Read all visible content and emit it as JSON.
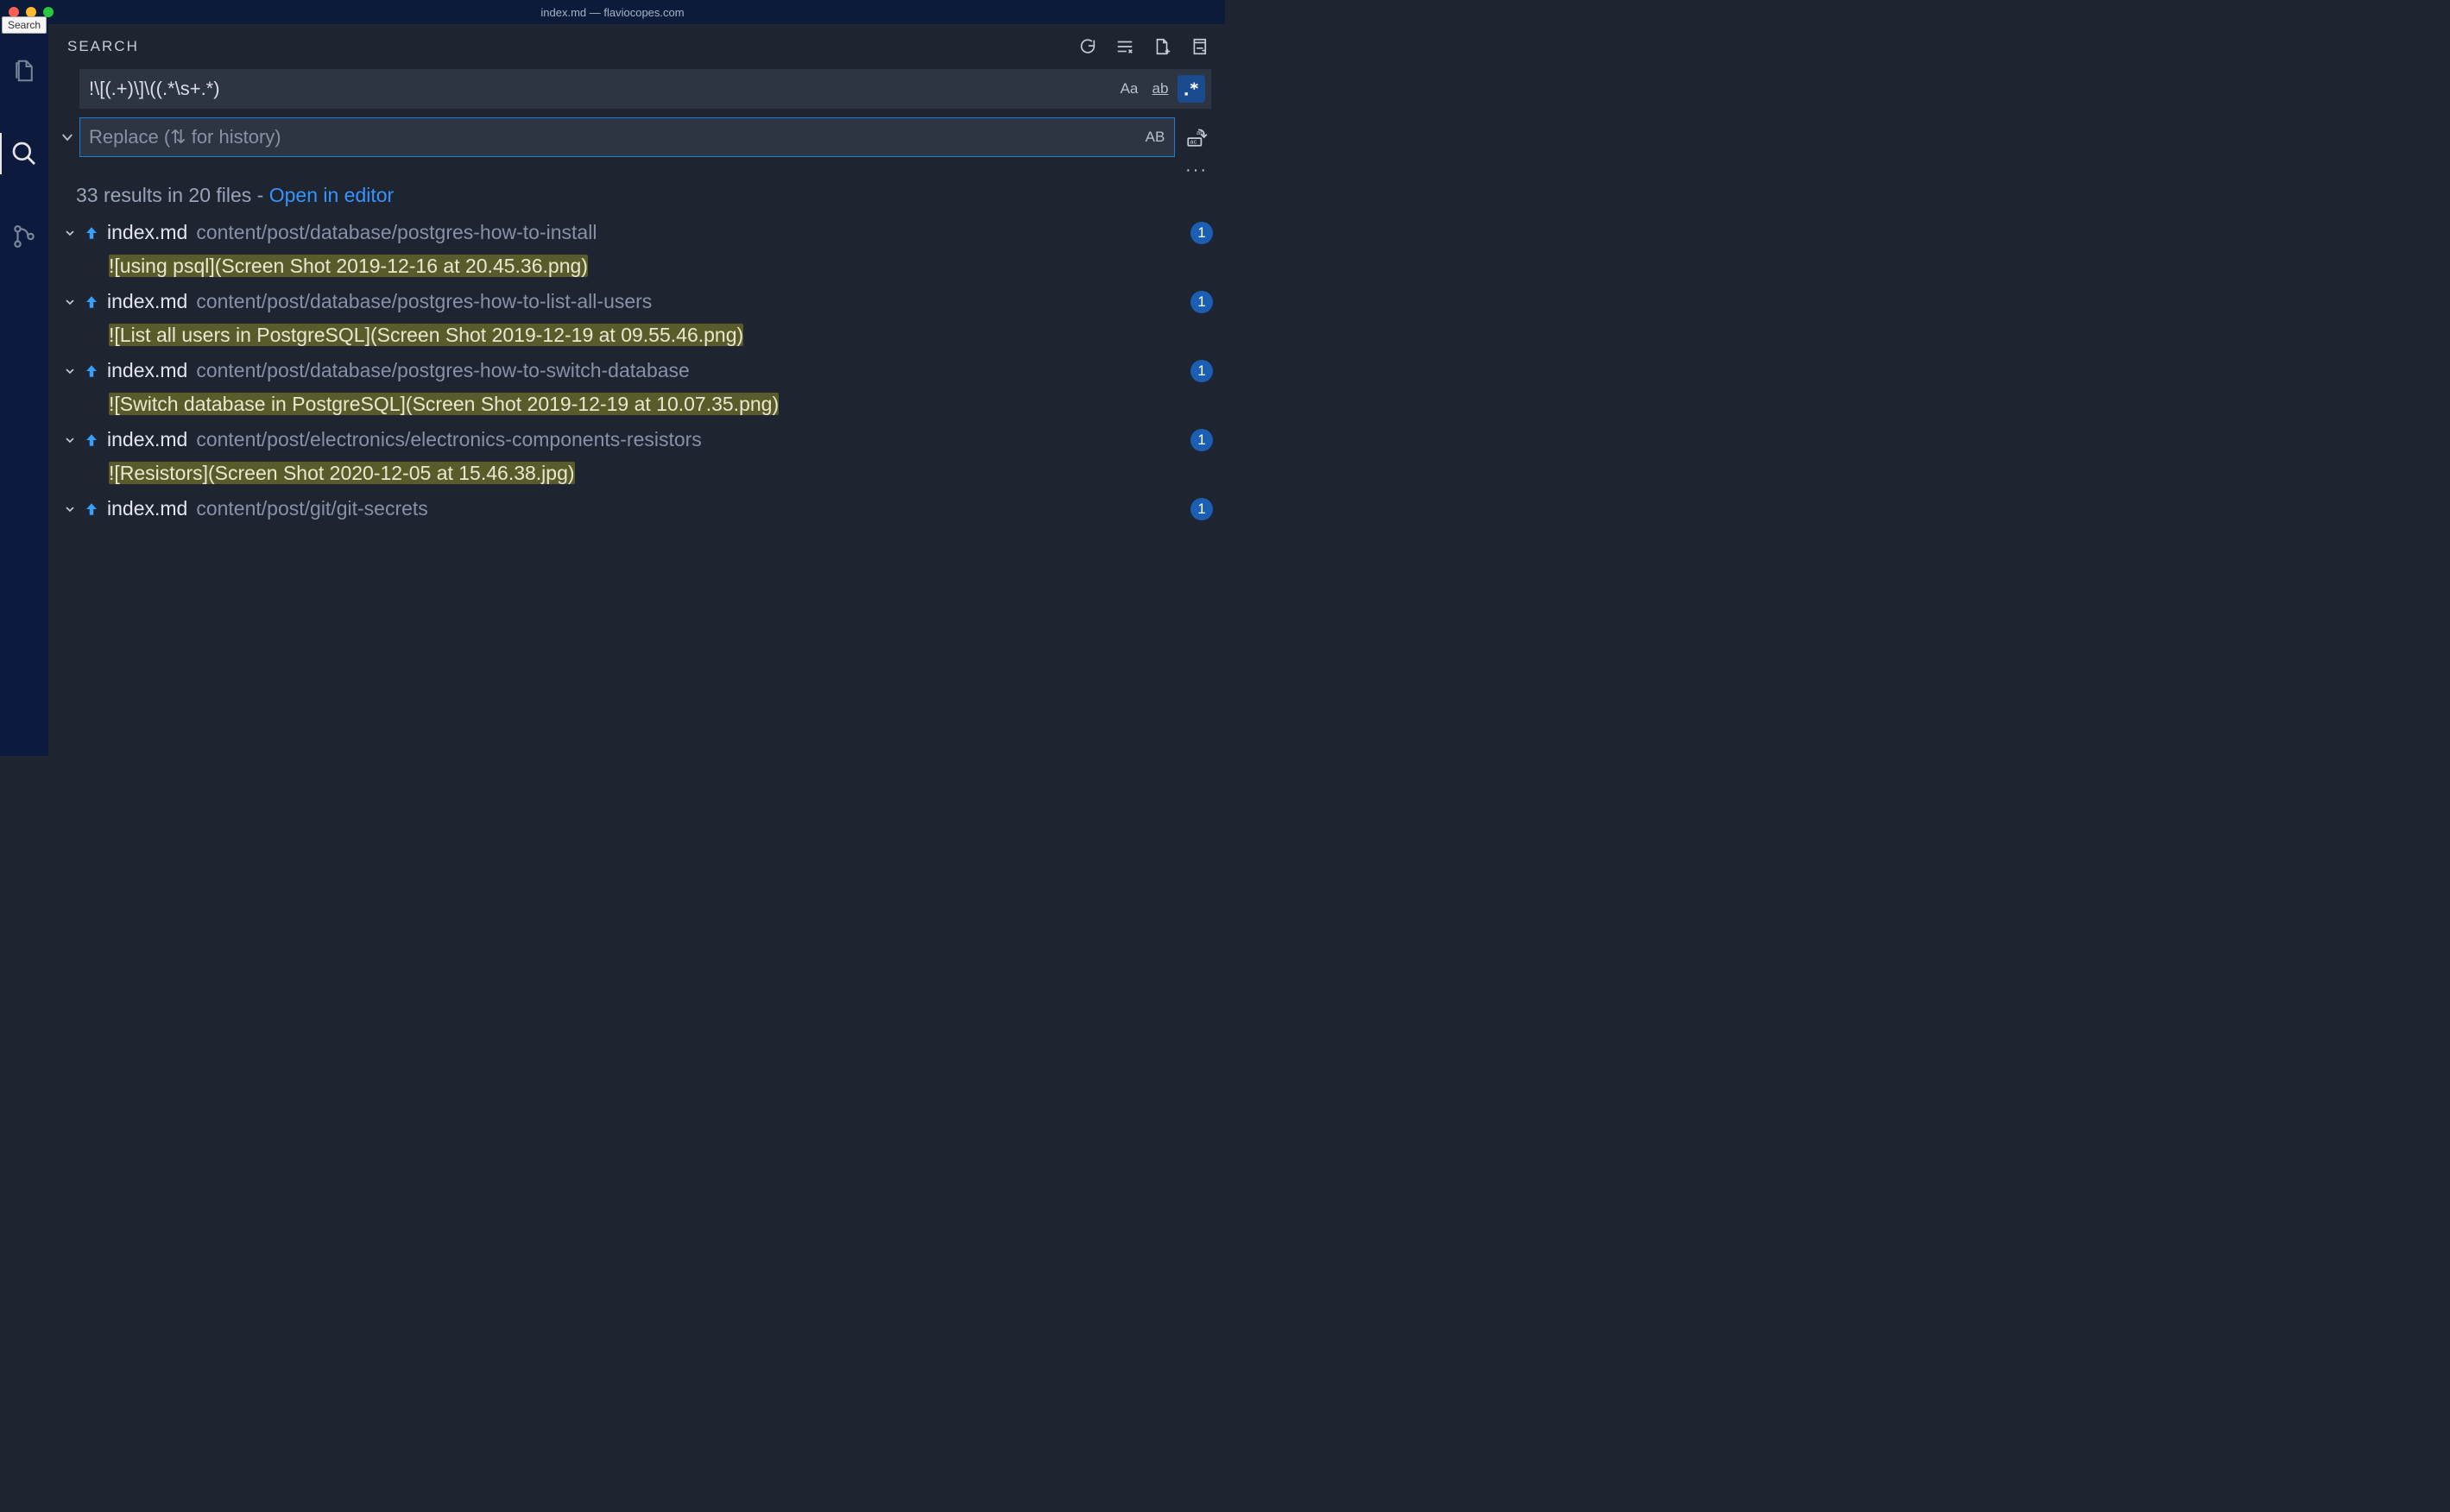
{
  "titlebar": {
    "title": "index.md — flaviocopes.com",
    "tooltip": "Search"
  },
  "panel": {
    "title": "SEARCH",
    "search_value": "!\\[(.+)\\]\\((.*\\s+.*)",
    "replace_placeholder": "Replace (⇅ for history)",
    "opts": {
      "case": "Aa",
      "word": "ab",
      "regex": "·*",
      "preserve": "AB"
    }
  },
  "summary": {
    "text": "33 results in 20 files - ",
    "link": "Open in editor"
  },
  "files": [
    {
      "name": "index.md",
      "path": "content/post/database/postgres-how-to-install",
      "count": "1",
      "match": "![using psql](Screen Shot 2019-12-16 at 20.45.36.png)"
    },
    {
      "name": "index.md",
      "path": "content/post/database/postgres-how-to-list-all-users",
      "count": "1",
      "match": "![List all users in PostgreSQL](Screen Shot 2019-12-19 at 09.55.46.png)"
    },
    {
      "name": "index.md",
      "path": "content/post/database/postgres-how-to-switch-database",
      "count": "1",
      "match": "![Switch database in PostgreSQL](Screen Shot 2019-12-19 at 10.07.35.png)"
    },
    {
      "name": "index.md",
      "path": "content/post/electronics/electronics-components-resistors",
      "count": "1",
      "match": "![Resistors](Screen Shot 2020-12-05 at 15.46.38.jpg)"
    },
    {
      "name": "index.md",
      "path": "content/post/git/git-secrets",
      "count": "1",
      "match": ""
    }
  ]
}
